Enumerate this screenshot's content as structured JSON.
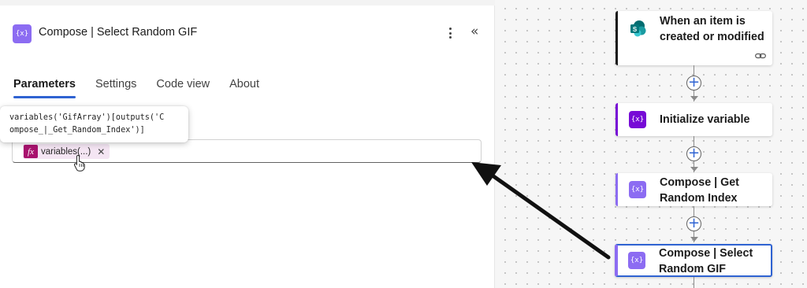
{
  "panel": {
    "title": "Compose | Select Random GIF",
    "header_icon_glyph": "{x}",
    "tabs": [
      {
        "label": "Parameters",
        "active": true
      },
      {
        "label": "Settings",
        "active": false
      },
      {
        "label": "Code view",
        "active": false
      },
      {
        "label": "About",
        "active": false
      }
    ],
    "tooltip": "variables('GifArray')[outputs('C\nompose_|_Get_Random_Index')]",
    "token": {
      "fx": "fx",
      "label": "variables(...)",
      "remove": "✕"
    },
    "collapse_glyph": "«"
  },
  "flow": {
    "steps": [
      {
        "title": "When an item is created or modified",
        "icon": "sharepoint-icon",
        "color": "#036c70"
      },
      {
        "title": "Initialize variable",
        "icon_glyph": "{x}",
        "color": "#770bd6"
      },
      {
        "title": "Compose | Get Random Index",
        "icon_glyph": "{x}",
        "color": "#8c6cf2"
      },
      {
        "title": "Compose | Select Random GIF",
        "icon_glyph": "{x}",
        "color": "#8c6cf2",
        "selected": true
      }
    ],
    "add_glyph": "+",
    "accent": "#2f63d2"
  }
}
